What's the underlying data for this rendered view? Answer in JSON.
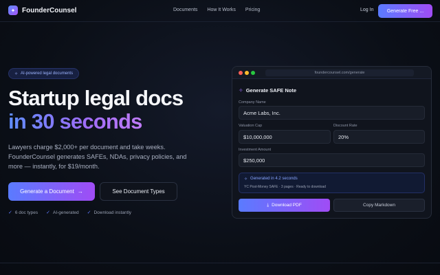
{
  "nav": {
    "brand": "FounderCounsel",
    "brand_icon": "sparkle-logo-icon",
    "links": [
      "Documents",
      "How It Works",
      "Pricing"
    ],
    "login": "Log In",
    "cta": "Generate Free ..."
  },
  "hero": {
    "badge": "AI-powered legal documents",
    "badge_icon": "sparkle-icon",
    "headline_line1": "Startup legal docs",
    "headline_line2": "in 30 seconds",
    "lede": "Lawyers charge $2,000+ per document and take weeks. FounderCounsel generates SAFEs, NDAs, privacy policies, and more — instantly, for $19/month.",
    "primary_button": "Generate a Document",
    "primary_arrow": "→",
    "secondary_button": "See Document Types",
    "features": [
      "6 doc types",
      "AI-generated",
      "Download instantly"
    ]
  },
  "mock": {
    "url": "foundercounsel.com/generate",
    "title": "Generate SAFE Note",
    "company_label": "Company Name",
    "company_value": "Acme Labs, Inc.",
    "valuation_label": "Valuation Cap",
    "valuation_value": "$10,000,000",
    "discount_label": "Discount Rate",
    "discount_value": "20%",
    "investment_label": "Investment Amount",
    "investment_value": "$250,000",
    "status_title": "Generated in 4.2 seconds",
    "status_detail": "YC Post-Money SAFE · 3 pages · Ready to download",
    "download_button": "Download PDF",
    "copy_button": "Copy Markdown"
  },
  "colors": {
    "accent_start": "#5a7bff",
    "accent_end": "#a04cf5",
    "background": "#0b0f17"
  }
}
